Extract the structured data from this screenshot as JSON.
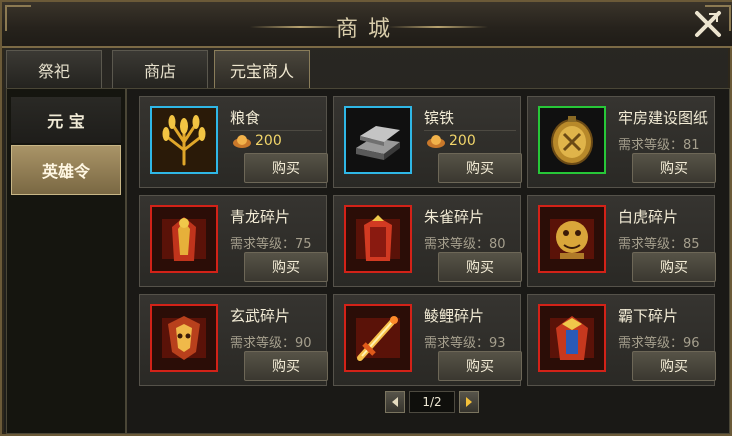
{
  "window": {
    "title": "商城"
  },
  "tabs": [
    {
      "label": "祭祀"
    },
    {
      "label": "商店"
    },
    {
      "label": "元宝商人",
      "active": true
    }
  ],
  "side_nav": [
    {
      "label": "元 宝",
      "selected": false
    },
    {
      "label": "英雄令",
      "selected": true
    }
  ],
  "buy_label": "购买",
  "items": [
    {
      "name": "粮食",
      "price": "200",
      "frame_color": "#2fb7e6",
      "icon": "grain-icon"
    },
    {
      "name": "镔铁",
      "price": "200",
      "frame_color": "#2fb7e6",
      "icon": "iron-ingot-icon"
    },
    {
      "name": "牢房建设图纸",
      "requirement": "需求等级：81",
      "frame_color": "#27c738",
      "icon": "blueprint-medal-icon"
    },
    {
      "name": "青龙碎片",
      "requirement": "需求等级：75",
      "frame_color": "#d32218",
      "icon": "armor-fragment-icon"
    },
    {
      "name": "朱雀碎片",
      "requirement": "需求等级：80",
      "frame_color": "#d32218",
      "icon": "armor-fragment-icon"
    },
    {
      "name": "白虎碎片",
      "requirement": "需求等级：85",
      "frame_color": "#d32218",
      "icon": "tiger-fragment-icon"
    },
    {
      "name": "玄武碎片",
      "requirement": "需求等级：90",
      "frame_color": "#d32218",
      "icon": "armor-fragment-icon"
    },
    {
      "name": "鲮鲤碎片",
      "requirement": "需求等级：93",
      "frame_color": "#d32218",
      "icon": "sword-icon"
    },
    {
      "name": "霸下碎片",
      "requirement": "需求等级：96",
      "frame_color": "#d32218",
      "icon": "armor-fragment-icon"
    }
  ],
  "pager": {
    "text": "1/2"
  }
}
